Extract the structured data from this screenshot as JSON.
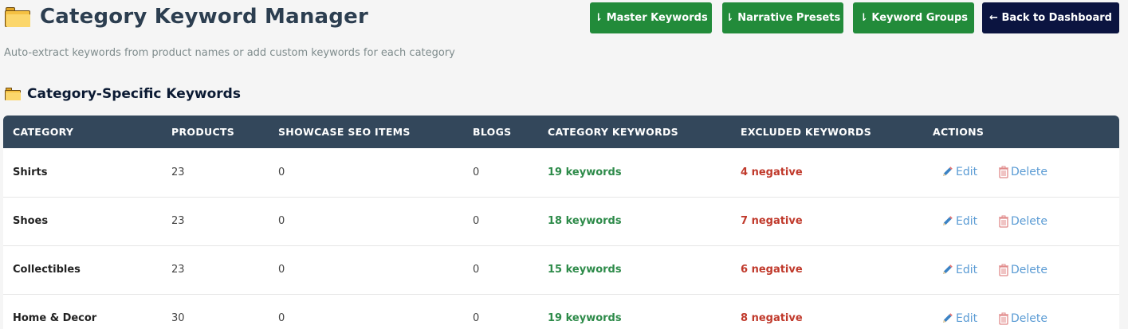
{
  "header": {
    "title": "Category Keyword Manager",
    "subtitle": "Auto-extract keywords from product names or add custom keywords for each category",
    "buttons": {
      "master": "⇂ Master Keywords",
      "narrative": "⇂ Narrative Presets",
      "groups": "⇂ Keyword Groups",
      "back": "← Back to Dashboard"
    }
  },
  "section": {
    "title": "Category-Specific Keywords"
  },
  "table": {
    "columns": [
      "Category",
      "Products",
      "Showcase SEO Items",
      "Blogs",
      "Category Keywords",
      "Excluded Keywords",
      "Actions"
    ],
    "rows": [
      {
        "category": "Shirts",
        "products": "23",
        "showcase": "0",
        "blogs": "0",
        "keywords": "19 keywords",
        "excluded": "4 negative"
      },
      {
        "category": "Shoes",
        "products": "23",
        "showcase": "0",
        "blogs": "0",
        "keywords": "18 keywords",
        "excluded": "7 negative"
      },
      {
        "category": "Collectibles",
        "products": "23",
        "showcase": "0",
        "blogs": "0",
        "keywords": "15 keywords",
        "excluded": "6 negative"
      },
      {
        "category": "Home & Decor",
        "products": "30",
        "showcase": "0",
        "blogs": "0",
        "keywords": "19 keywords",
        "excluded": "8 negative"
      }
    ],
    "actions": {
      "edit": "Edit",
      "delete": "Delete"
    }
  },
  "colors": {
    "button_green": "#228b3a",
    "button_navy": "#0b1440",
    "table_header": "#33475b",
    "keyword_green": "#2e8b4a",
    "negative_red": "#c0392b",
    "link_blue": "#5a9bd4"
  },
  "icons": {
    "title": "folder-icon",
    "section": "folder-icon",
    "edit": "pencil-icon",
    "delete": "trash-icon"
  }
}
